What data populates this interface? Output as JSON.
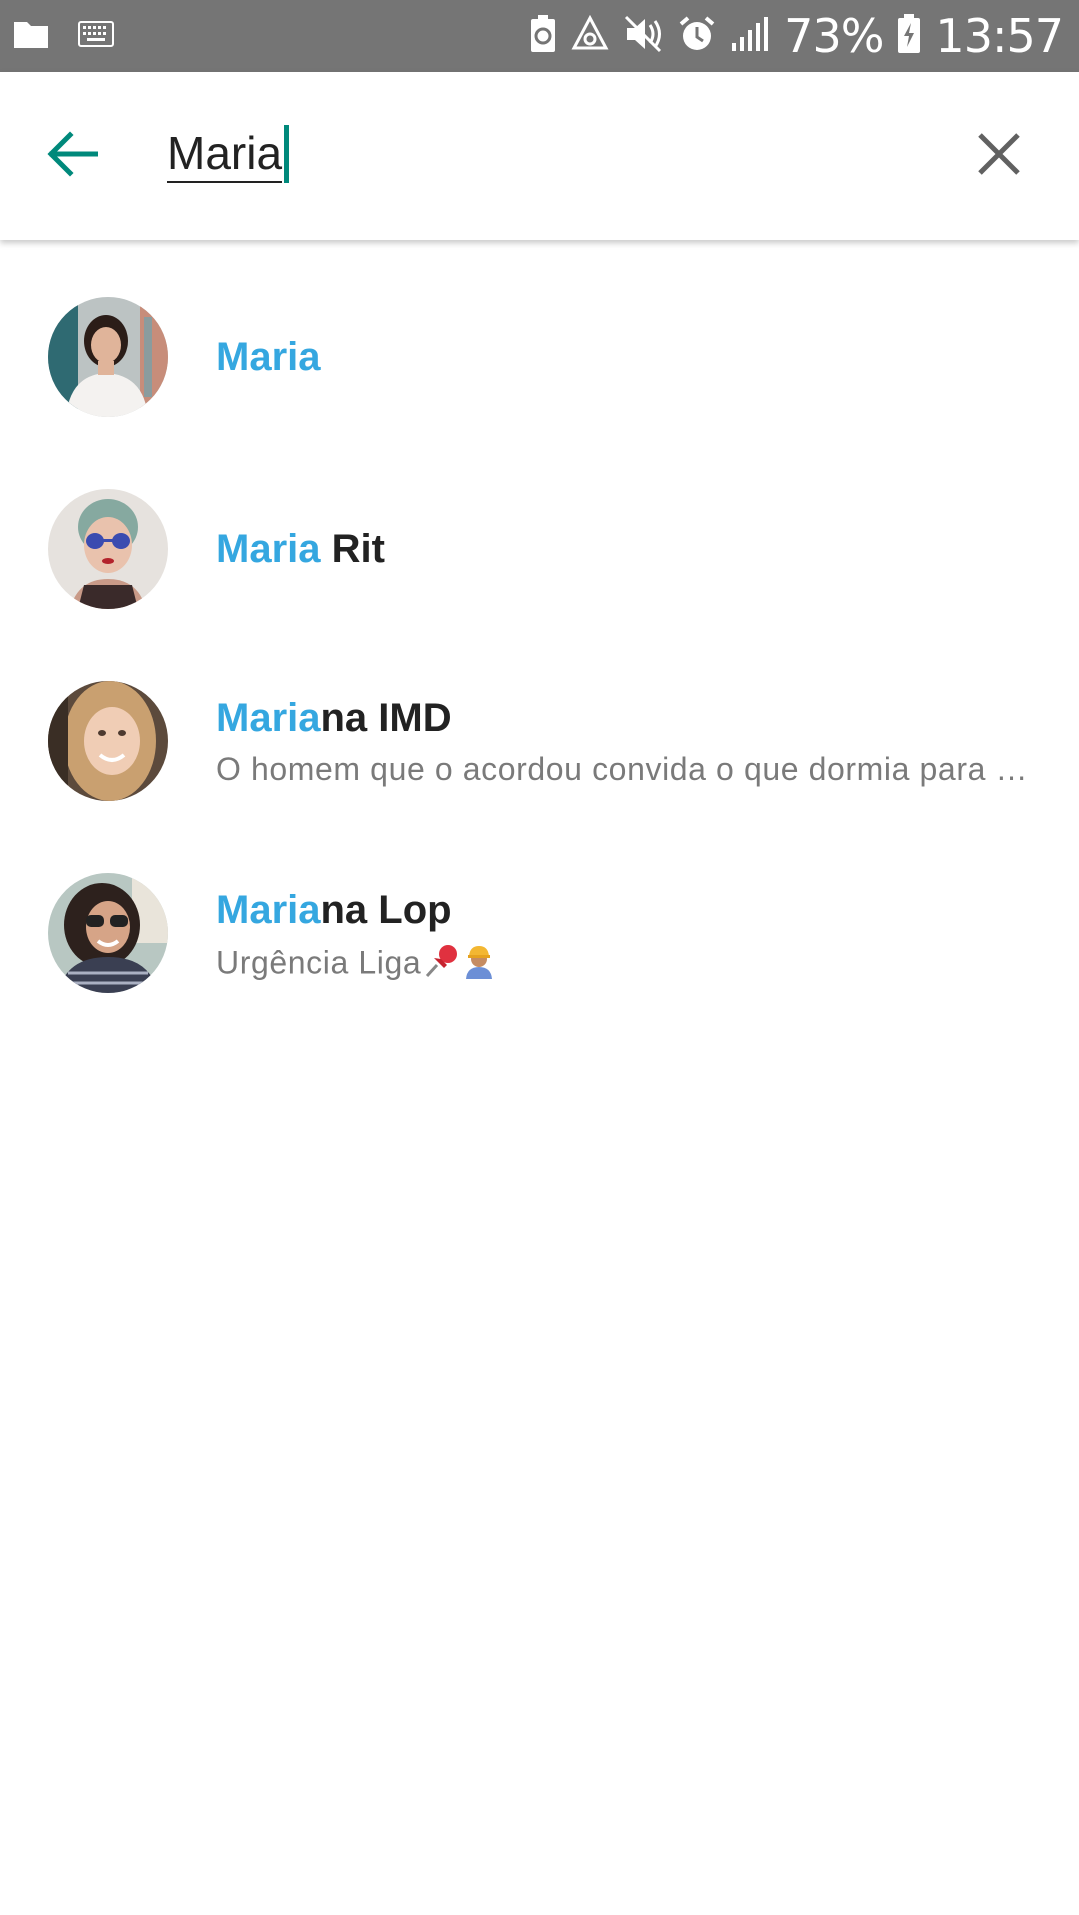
{
  "status_bar": {
    "battery": "73%",
    "time": "13:57",
    "icons_left": [
      "folder-icon",
      "keyboard-icon"
    ],
    "icons_right": [
      "battery-saver-icon",
      "recycle-icon",
      "mute-icon",
      "alarm-icon",
      "signal-icon",
      "battery-charging-icon"
    ]
  },
  "search": {
    "query": "Maria",
    "back_icon": "arrow-left-icon",
    "clear_icon": "close-icon",
    "accent_color": "#00897b"
  },
  "results": [
    {
      "highlight": "Maria",
      "rest": "",
      "status": ""
    },
    {
      "highlight": "Maria",
      "rest": " Rit",
      "status": ""
    },
    {
      "highlight": "Maria",
      "rest": "na IMD",
      "status": "O homem que o acordou convida o que dormia para vir comer"
    },
    {
      "highlight": "Maria",
      "rest": "na Lop",
      "status": "Urgência Liga",
      "status_icons": [
        "pushpin-icon",
        "construction-worker-icon"
      ]
    }
  ],
  "colors": {
    "highlight": "#35a7e0",
    "status_bar": "#757575"
  }
}
